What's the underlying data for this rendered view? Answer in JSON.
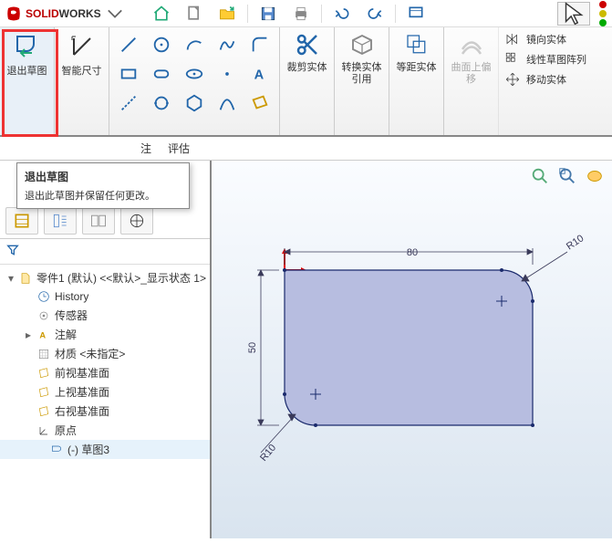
{
  "app": {
    "brand_prefix": "SOLID",
    "brand_suffix": "WORKS"
  },
  "ribbon": {
    "exit_sketch": "退出草图",
    "smart_dim": "智能尺寸",
    "trim": "裁剪实体",
    "convert": "转换实体引用",
    "offset": "等距实体",
    "curve_on": "曲面上偏移",
    "mirror": "镜向实体",
    "linear_pattern": "线性草图阵列",
    "move": "移动实体"
  },
  "tabs": {
    "t1": "注",
    "t2": "评估"
  },
  "tooltip": {
    "title": "退出草图",
    "body": "退出此草图并保留任何更改。"
  },
  "tree": {
    "root": "零件1 (默认) <<默认>_显示状态 1>",
    "history": "History",
    "sensors": "传感器",
    "annotations": "注解",
    "material": "材质 <未指定>",
    "front": "前视基准面",
    "top": "上视基准面",
    "right": "右视基准面",
    "origin": "原点",
    "sketch": "(-) 草图3"
  },
  "chart_data": {
    "type": "diagram",
    "shape": "rounded-rectangle",
    "dimensions": {
      "width": 80,
      "height": 50,
      "corner_radius": 10
    },
    "dim_labels": {
      "width": "80",
      "height": "50",
      "r1": "R10",
      "r2": "R10"
    }
  }
}
